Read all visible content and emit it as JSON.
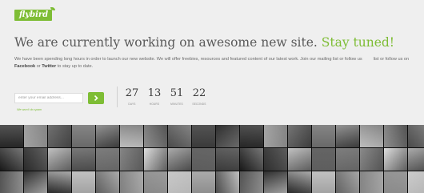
{
  "brand": {
    "name": "flybird",
    "accent_color": "#7ebd35"
  },
  "hero": {
    "headline_main": "We are currently working on awesome new site.",
    "headline_accent": "Stay tuned!"
  },
  "intro": {
    "text_1": "We have been spending long hours in order to launch our new website. We will offer freebies, resources and featured content of our latest work. Join our mailing list or follow us",
    "text_2": "list or follow us on",
    "facebook_label": "Facebook",
    "or_label": "or",
    "twitter_label": "Twitter",
    "text_3": "to stay up to date."
  },
  "signup": {
    "email_placeholder": "enter your email address...",
    "submit_icon": "arrow-right-icon",
    "note": "We won't do spam"
  },
  "countdown": [
    {
      "value": "27",
      "label": "DAYS"
    },
    {
      "value": "13",
      "label": "HOURS"
    },
    {
      "value": "51",
      "label": "MINUTES"
    },
    {
      "value": "22",
      "label": "SECONDS"
    }
  ]
}
